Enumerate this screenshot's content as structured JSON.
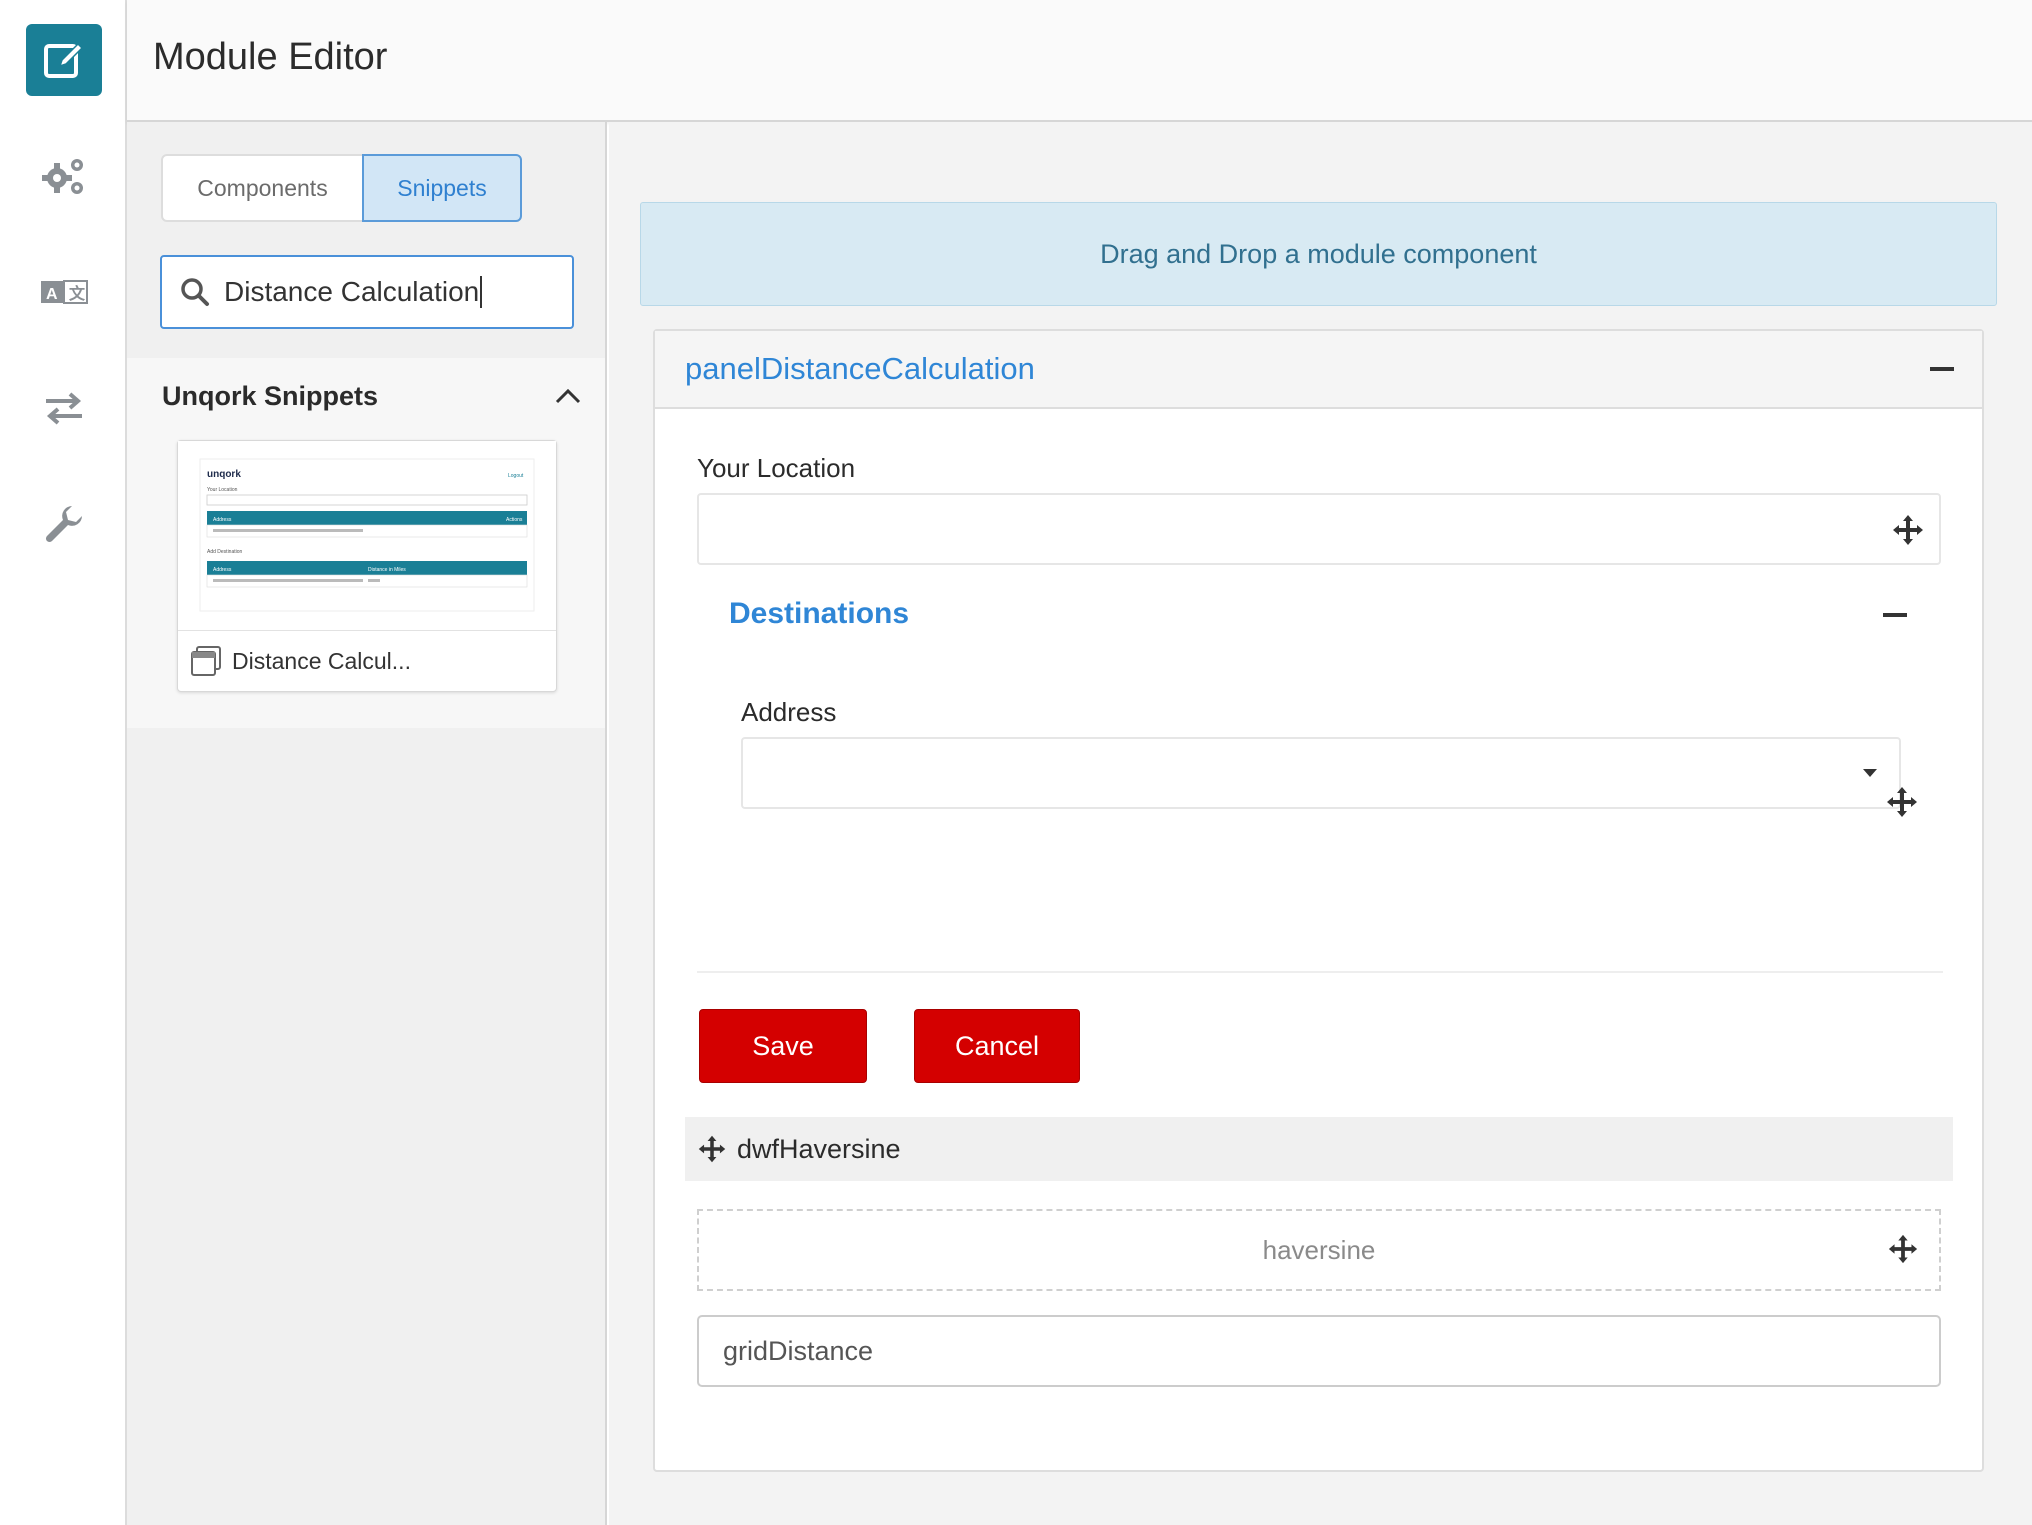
{
  "header": {
    "title": "Module Editor"
  },
  "rail": {
    "items": [
      {
        "icon": "edit-icon",
        "active": true
      },
      {
        "icon": "gears-icon"
      },
      {
        "icon": "translate-icon"
      },
      {
        "icon": "swap-arrows-icon"
      },
      {
        "icon": "wrench-icon"
      }
    ],
    "accent": "#1a7f96"
  },
  "side": {
    "tabs": {
      "components": "Components",
      "snippets": "Snippets"
    },
    "search": {
      "value": "Distance Calculation"
    },
    "section": {
      "title": "Unqork Snippets",
      "card": {
        "label": "Distance Calcul...",
        "thumb": {
          "brand": "unqork",
          "link": "Logout",
          "location_label": "Your Location",
          "header_col1": "Address",
          "header_col2": "Actions",
          "section_label": "Add Destination",
          "table_col1": "Address",
          "table_col2": "Distance in Miles"
        }
      }
    }
  },
  "main": {
    "drop_hint": "Drag and Drop a module component",
    "panel": {
      "title": "panelDistanceCalculation",
      "your_location_label": "Your Location",
      "destinations": {
        "title": "Destinations",
        "address_label": "Address"
      },
      "save_label": "Save",
      "cancel_label": "Cancel",
      "dwf_label": "dwfHaversine",
      "haversine_label": "haversine",
      "grid_label": "gridDistance"
    }
  },
  "colors": {
    "link_blue": "#2f86d6",
    "button_red": "#d40000",
    "hint_bg": "#d8eaf3"
  }
}
